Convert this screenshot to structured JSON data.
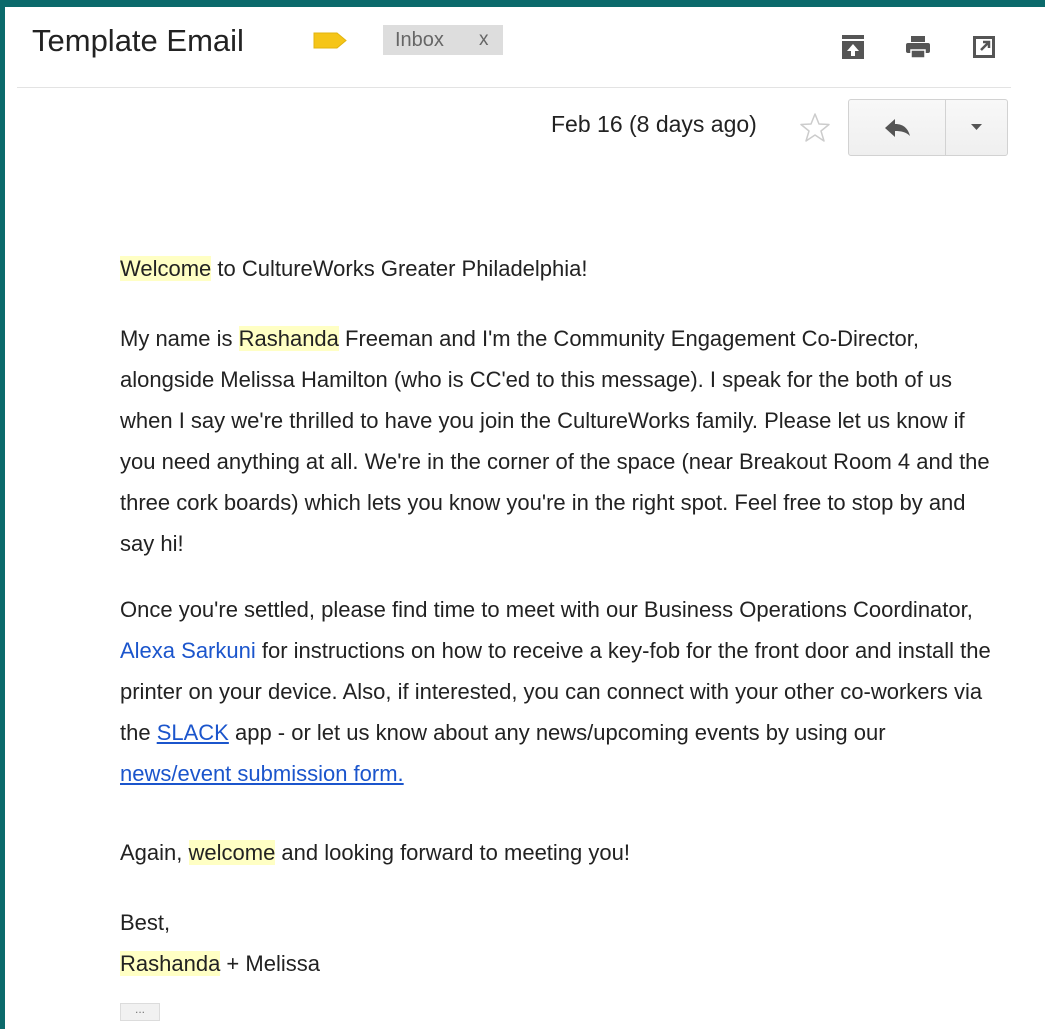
{
  "email": {
    "subject": "Template Email",
    "label_chip": {
      "text": "Inbox",
      "remove": "x"
    },
    "date": "Feb 16 (8 days ago)",
    "toolbar": {
      "archive_icon": "archive-icon",
      "print_icon": "print-icon",
      "new_window_icon": "open-in-new-window-icon"
    },
    "body": {
      "greeting": {
        "hl": "Welcome",
        "rest": " to CultureWorks Greater Philadelphia!"
      },
      "para1": {
        "a": "My name is ",
        "hl": "Rashanda",
        "b": " Freeman and I'm the Community Engagement Co-Director, alongside Melissa Hamilton (who is CC'ed to this message). I speak for the both of us when I say we're thrilled to have you join the CultureWorks family. Please let us know if you need anything at all. We're in the corner of the space (near Breakout Room 4 and the three cork boards) which lets you know you're in the right spot. Feel free to stop by and say hi!"
      },
      "para2": {
        "a": "Once you're settled, please find time to meet with our Business Operations Coordinator, ",
        "link1": "Alexa Sarkuni",
        "b": " for instructions on how to receive a key-fob for the front door and install the printer on your device. Also, if interested, you can connect with your other co-workers via the ",
        "link2": "SLACK",
        "c": " app  - or let us know about any news/upcoming events by using our ",
        "link3": "news/event submission form."
      },
      "para3": {
        "a": "Again, ",
        "hl": "welcome",
        "b": " and looking forward to meeting you!"
      },
      "signoff": {
        "line1": "Best,",
        "hl": "Rashanda",
        "rest": " + Melissa"
      },
      "trimmed_content": "..."
    }
  },
  "colors": {
    "background": "#0b6a6b",
    "highlight": "#ffffc4",
    "link": "#1b55cc",
    "label_tag": "#f5c518"
  }
}
